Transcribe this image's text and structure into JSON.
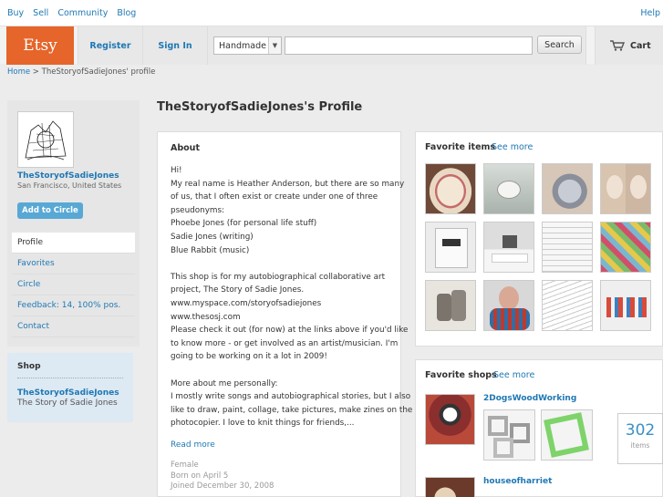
{
  "topnav": {
    "links": [
      "Buy",
      "Sell",
      "Community",
      "Blog"
    ],
    "help": "Help"
  },
  "header": {
    "logo": "Etsy",
    "register": "Register",
    "signin": "Sign In",
    "search_category": "Handmade",
    "search_button": "Search",
    "cart": "Cart"
  },
  "breadcrumb": {
    "home": "Home",
    "separator": " > ",
    "current": "TheStoryofSadieJones' profile"
  },
  "sidebar": {
    "shop_name": "TheStoryofSadieJones",
    "location": "San Francisco, United States",
    "add_circle": "Add to Circle",
    "menu": [
      "Profile",
      "Favorites",
      "Circle",
      "Feedback: 14, 100% pos.",
      "Contact"
    ]
  },
  "shop_box": {
    "title": "Shop",
    "name": "TheStoryofSadieJones",
    "subtitle": "The Story of Sadie Jones"
  },
  "profile_title": "TheStoryofSadieJones's Profile",
  "about": {
    "heading": "About",
    "lines": [
      "Hi!",
      "My real name is Heather Anderson, but there are so many",
      "of us, that I often exist or create under one of three",
      "pseudonyms:",
      "Phoebe Jones (for personal life stuff)",
      "Sadie Jones (writing)",
      "Blue Rabbit (music)",
      "",
      "This shop is for my autobiographical collaborative art",
      "project, The Story of Sadie Jones.",
      "www.myspace.com/storyofsadiejones",
      "www.thesosj.com",
      "Please check it out (for now) at the links above if you'd like",
      "to know more - or get involved as an artist/musician. I'm",
      "going to be working on it a lot in 2009!",
      "",
      "More about me personally:",
      "I mostly write songs and autobiographical stories, but I also",
      "like to draw, paint, collage, take pictures, make zines on the",
      "photocopier. I love to knit things for friends,..."
    ],
    "read_more": "Read more",
    "meta": [
      "Female",
      "Born on April 5",
      "Joined December 30, 2008"
    ]
  },
  "favorite_items": {
    "heading": "Favorite items",
    "see_more": "See more"
  },
  "favorite_shops": {
    "heading": "Favorite shops",
    "see_more": "See more",
    "shops": [
      "2DogsWoodWorking",
      "houseofharriet"
    ],
    "count": "302",
    "count_label": "items"
  },
  "colors": {
    "accent": "#e5652a",
    "link": "#1f78b4",
    "button": "#58a8d5"
  }
}
